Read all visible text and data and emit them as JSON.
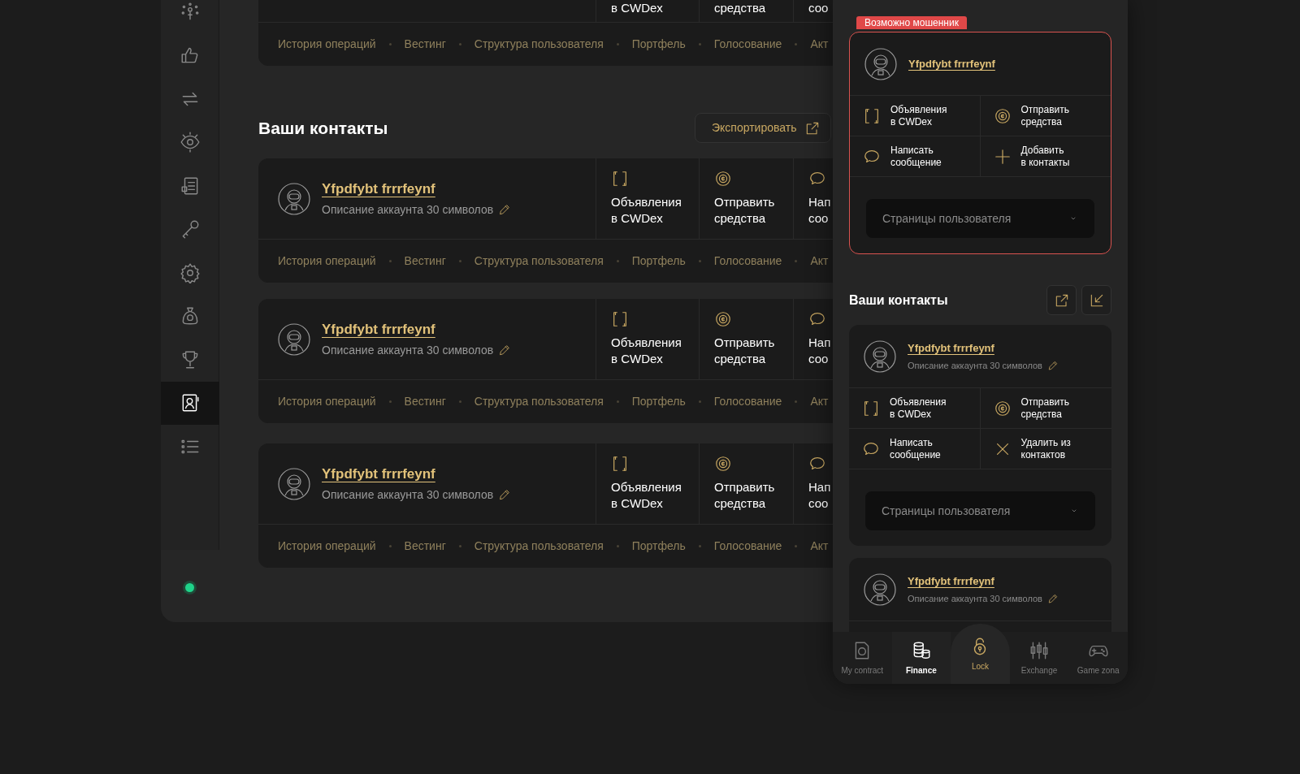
{
  "sidebar": {
    "items": [
      {
        "kind": "network",
        "selected": false
      },
      {
        "kind": "like",
        "selected": false
      },
      {
        "kind": "exchange",
        "selected": false
      },
      {
        "kind": "eye",
        "selected": false
      },
      {
        "kind": "document",
        "selected": false
      },
      {
        "kind": "key",
        "selected": false
      },
      {
        "kind": "gear",
        "selected": false
      },
      {
        "kind": "bag",
        "selected": false
      },
      {
        "kind": "trophy",
        "selected": false
      },
      {
        "kind": "contacts",
        "selected": true
      },
      {
        "kind": "list",
        "selected": false
      }
    ]
  },
  "top_card": {
    "actions": [
      {
        "label": "в CWDex"
      },
      {
        "label": "средства"
      },
      {
        "label": "соо"
      }
    ],
    "links": [
      "История операций",
      "Вестинг",
      "Структура пользователя",
      "Портфель",
      "Голосование",
      "Акт"
    ]
  },
  "contacts_section": {
    "title": "Ваши контакты",
    "export_button": "Экспортировать"
  },
  "contacts": [
    {
      "name": "Yfpdfybt frrrfeynf",
      "description": "Описание аккаунта 30 символов",
      "actions": [
        {
          "kind": "ads",
          "label": "Объявления\nв CWDex"
        },
        {
          "kind": "send",
          "label": "Отправить\nсредства"
        },
        {
          "kind": "message",
          "label": "Нап\nсоо"
        }
      ],
      "links": [
        "История операций",
        "Вестинг",
        "Структура пользователя",
        "Портфель",
        "Голосование",
        "Акт"
      ]
    },
    {
      "name": "Yfpdfybt frrrfeynf",
      "description": "Описание аккаунта 30 символов",
      "actions": [
        {
          "kind": "ads",
          "label": "Объявления\nв CWDex"
        },
        {
          "kind": "send",
          "label": "Отправить\nсредства"
        },
        {
          "kind": "message",
          "label": "Нап\nсоо"
        }
      ],
      "links": [
        "История операций",
        "Вестинг",
        "Структура пользователя",
        "Портфель",
        "Голосование",
        "Акт"
      ]
    },
    {
      "name": "Yfpdfybt frrrfeynf",
      "description": "Описание аккаунта 30 символов",
      "actions": [
        {
          "kind": "ads",
          "label": "Объявления\nв CWDex"
        },
        {
          "kind": "send",
          "label": "Отправить\nсредства"
        },
        {
          "kind": "message",
          "label": "Нап\nсоо"
        }
      ],
      "links": [
        "История операций",
        "Вестинг",
        "Структура пользователя",
        "Портфель",
        "Голосование",
        "Акт"
      ]
    }
  ],
  "mobile": {
    "fraud_card": {
      "badge": "Возможно мошенник",
      "name": "Yfpdfybt frrrfeynf",
      "actions": [
        {
          "kind": "ads",
          "label": "Объявления\nв CWDex"
        },
        {
          "kind": "send",
          "label": "Отправить\nсредства"
        },
        {
          "kind": "message",
          "label": "Написать\nсообщение"
        },
        {
          "kind": "add",
          "label": "Добавить\nв контакты"
        }
      ],
      "select": "Страницы пользователя"
    },
    "contacts_title": "Ваши контакты",
    "contacts": [
      {
        "name": "Yfpdfybt frrrfeynf",
        "description": "Описание аккаунта 30 символов",
        "actions": [
          {
            "kind": "ads",
            "label": "Объявления\nв CWDex"
          },
          {
            "kind": "send",
            "label": "Отправить\nсредства"
          },
          {
            "kind": "message",
            "label": "Написать\nсообщение"
          },
          {
            "kind": "remove",
            "label": "Удалить из\nконтактов"
          }
        ],
        "select": "Страницы пользователя"
      },
      {
        "name": "Yfpdfybt frrrfeynf",
        "description": "Описание аккаунта 30 символов"
      }
    ],
    "nav": [
      {
        "kind": "contract",
        "label": "My contract",
        "selected": false
      },
      {
        "kind": "finance",
        "label": "Finance",
        "selected": true
      },
      {
        "kind": "lock",
        "label": "Lock",
        "selected": false
      },
      {
        "kind": "exchange",
        "label": "Exchange",
        "selected": false
      },
      {
        "kind": "game",
        "label": "Game zona",
        "selected": false
      }
    ]
  }
}
